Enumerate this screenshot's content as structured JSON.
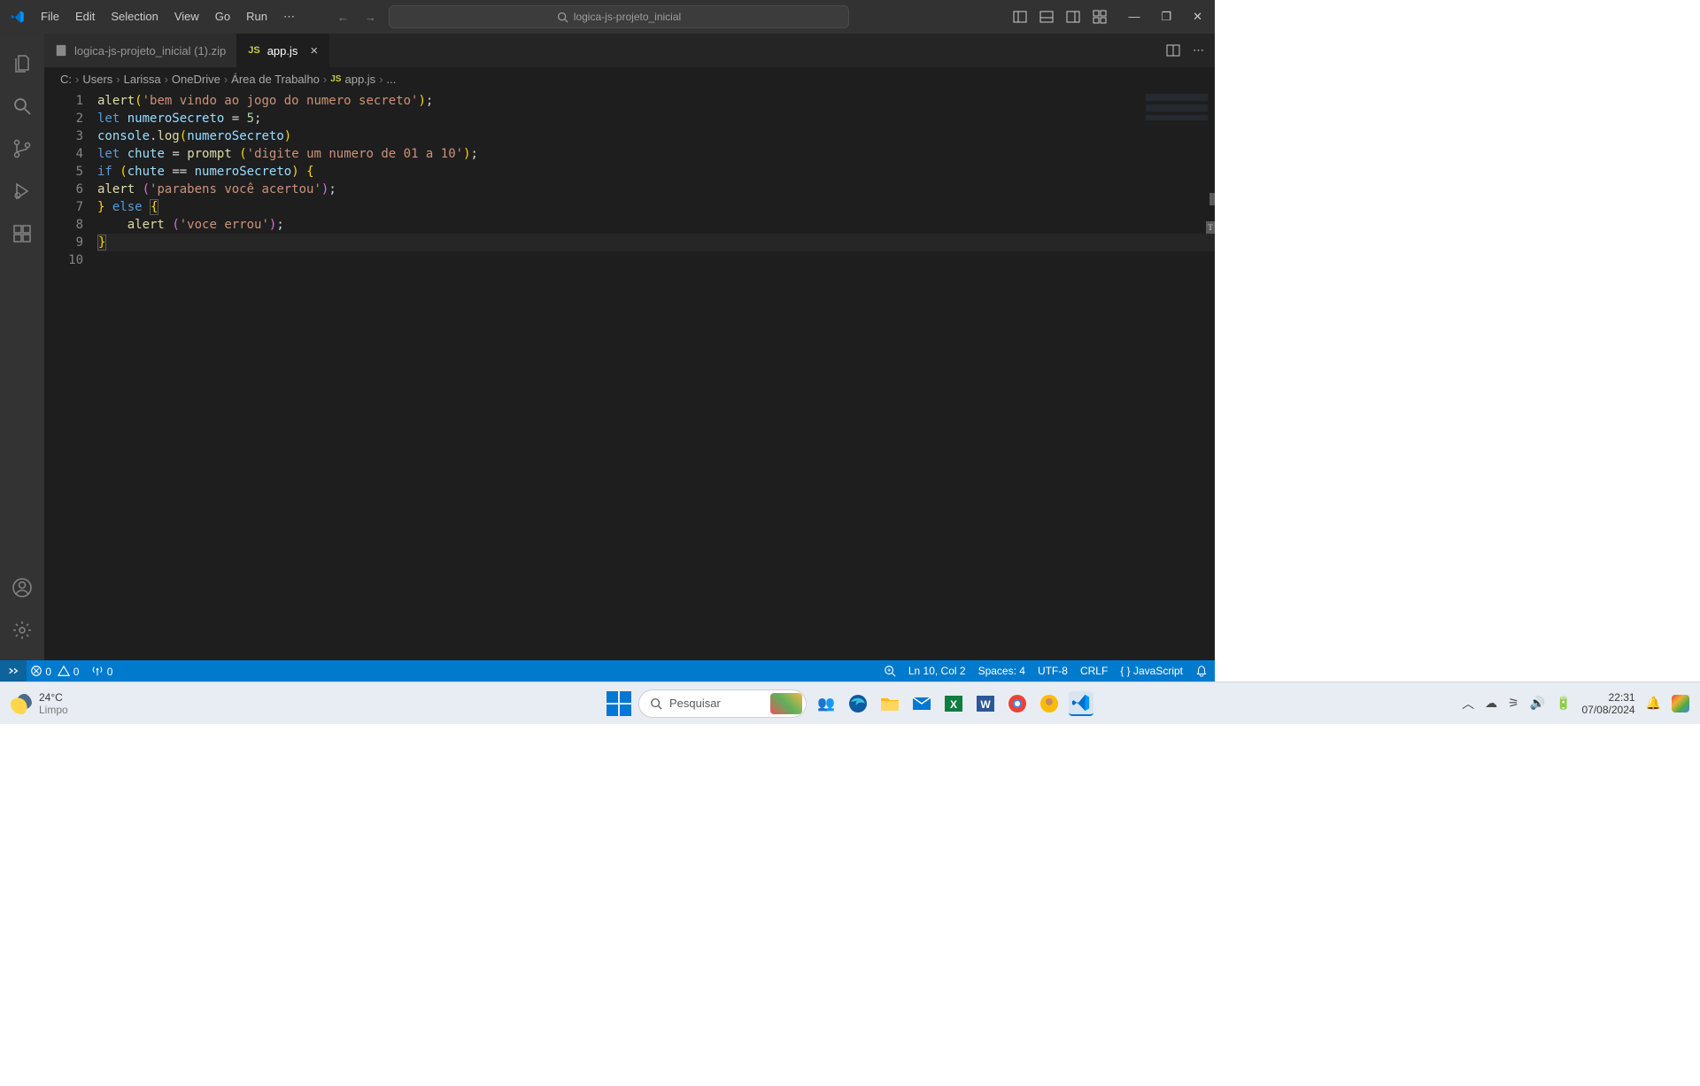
{
  "menu": {
    "file": "File",
    "edit": "Edit",
    "selection": "Selection",
    "view": "View",
    "go": "Go",
    "run": "Run"
  },
  "commandCenter": {
    "text": "logica-js-projeto_inicial"
  },
  "tabs": {
    "inactive": {
      "label": "logica-js-projeto_inicial (1).zip"
    },
    "active": {
      "label": "app.js",
      "langBadge": "JS"
    }
  },
  "breadcrumbs": {
    "c": "C:",
    "users": "Users",
    "larissa": "Larissa",
    "onedrive": "OneDrive",
    "desktop": "Área de Trabalho",
    "jsBadge": "JS",
    "file": "app.js",
    "ellipsis": "..."
  },
  "code": {
    "lines": [
      1,
      2,
      3,
      4,
      5,
      6,
      7,
      8,
      9,
      10
    ],
    "l1": {
      "fn": "alert",
      "str": "'bem vindo ao jogo do numero secreto'"
    },
    "l2": {
      "kw": "let",
      "var": "numeroSecreto",
      "num": "5"
    },
    "l3": {
      "obj": "console",
      "fn": "log",
      "var": "numeroSecreto"
    },
    "l4": {
      "kw": "let",
      "var": "chute",
      "fn": "prompt",
      "str": "'digite um numero de 01 a 10'"
    },
    "l6": {
      "kw": "if",
      "v1": "chute",
      "op": "==",
      "v2": "numeroSecreto"
    },
    "l7": {
      "fn": "alert",
      "str": "'parabens você acertou'"
    },
    "l8": {
      "kw": "else"
    },
    "l9": {
      "fn": "alert",
      "str": "'voce errou'"
    }
  },
  "status": {
    "errors": "0",
    "warnings": "0",
    "ports": "0",
    "lncol": "Ln 10, Col 2",
    "spaces": "Spaces: 4",
    "encoding": "UTF-8",
    "eol": "CRLF",
    "lang": "JavaScript"
  },
  "taskbar": {
    "weatherTemp": "24°C",
    "weatherCond": "Limpo",
    "search": "Pesquisar",
    "time": "22:31",
    "date": "07/08/2024"
  }
}
